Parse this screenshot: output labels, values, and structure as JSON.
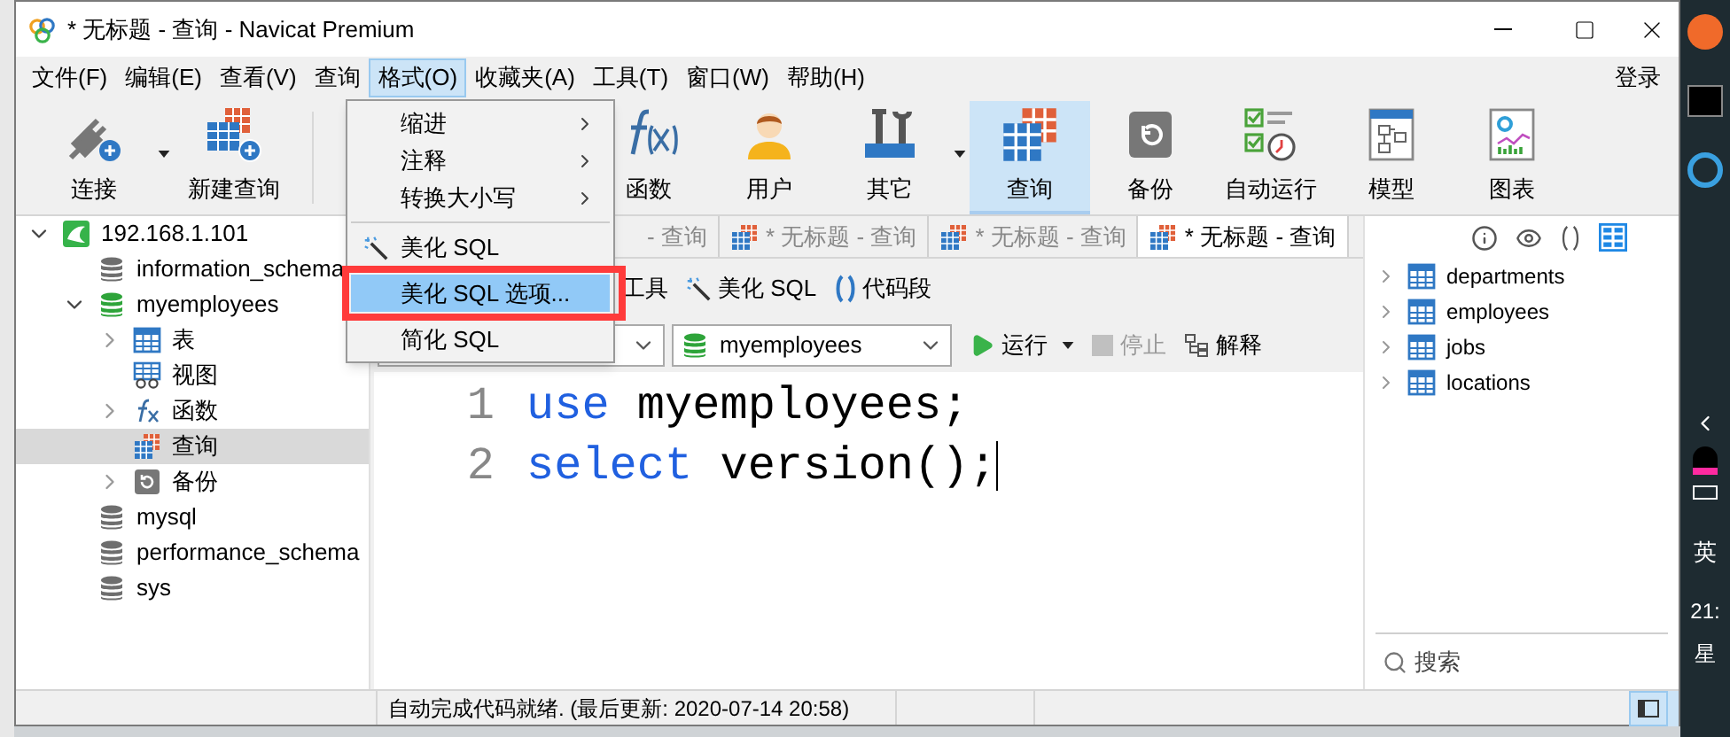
{
  "window": {
    "title": "* 无标题 - 查询 - Navicat Premium"
  },
  "menu_bar": {
    "items": [
      {
        "label": "文件(F)",
        "selected": false
      },
      {
        "label": "编辑(E)",
        "selected": false
      },
      {
        "label": "查看(V)",
        "selected": false
      },
      {
        "label": "查询",
        "selected": false
      },
      {
        "label": "格式(O)",
        "selected": true
      },
      {
        "label": "收藏夹(A)",
        "selected": false
      },
      {
        "label": "工具(T)",
        "selected": false
      },
      {
        "label": "窗口(W)",
        "selected": false
      },
      {
        "label": "帮助(H)",
        "selected": false
      }
    ],
    "login": "登录"
  },
  "toolbar": {
    "items": [
      {
        "label": "连接",
        "kind": "plug",
        "selected": false,
        "dropdown": true
      },
      {
        "label": "新建查询",
        "kind": "newquery",
        "selected": false,
        "dropdown": false
      },
      {
        "label": "函数",
        "kind": "function",
        "selected": false,
        "dropdown": false
      },
      {
        "label": "用户",
        "kind": "user",
        "selected": false,
        "dropdown": false
      },
      {
        "label": "其它",
        "kind": "tools",
        "selected": false,
        "dropdown": true
      },
      {
        "label": "查询",
        "kind": "query",
        "selected": true,
        "dropdown": false
      },
      {
        "label": "备份",
        "kind": "backup",
        "selected": false,
        "dropdown": false
      },
      {
        "label": "自动运行",
        "kind": "schedule",
        "selected": false,
        "dropdown": false
      },
      {
        "label": "模型",
        "kind": "model",
        "selected": false,
        "dropdown": false
      },
      {
        "label": "图表",
        "kind": "chart",
        "selected": false,
        "dropdown": false
      }
    ]
  },
  "format_menu": {
    "items": [
      {
        "label": "缩进",
        "kind": "submenu",
        "selected": false,
        "separator_before": false
      },
      {
        "label": "注释",
        "kind": "submenu",
        "selected": false,
        "separator_before": false
      },
      {
        "label": "转换大小写",
        "kind": "submenu",
        "selected": false,
        "separator_before": false
      },
      {
        "label": "美化 SQL",
        "kind": "wand",
        "selected": false,
        "separator_before": true
      },
      {
        "label": "美化 SQL 选项...",
        "kind": "item",
        "selected": true,
        "separator_before": false
      },
      {
        "label": "简化 SQL",
        "kind": "item",
        "selected": false,
        "separator_before": false
      }
    ]
  },
  "tree": [
    {
      "label": "192.168.1.101",
      "kind": "connection",
      "expanded": true,
      "selected": false,
      "children": [
        {
          "label": "information_schema",
          "kind": "db",
          "selected": false
        },
        {
          "label": "myemployees",
          "kind": "db_open",
          "expanded": true,
          "selected": false,
          "children": [
            {
              "label": "表",
              "kind": "table",
              "expandable": true,
              "selected": false
            },
            {
              "label": "视图",
              "kind": "view",
              "expandable": false,
              "selected": false
            },
            {
              "label": "函数",
              "kind": "function",
              "expandable": true,
              "selected": false
            },
            {
              "label": "查询",
              "kind": "query",
              "expandable": false,
              "selected": true
            },
            {
              "label": "备份",
              "kind": "backup",
              "expandable": true,
              "selected": false
            }
          ]
        },
        {
          "label": "mysql",
          "kind": "db",
          "selected": false
        },
        {
          "label": "performance_schema",
          "kind": "db",
          "selected": false
        },
        {
          "label": "sys",
          "kind": "db",
          "selected": false
        }
      ]
    }
  ],
  "editor": {
    "tabs": [
      {
        "label": "- 查询",
        "selected": false,
        "icon": false
      },
      {
        "label": "* 无标题 - 查询",
        "selected": false,
        "icon": true
      },
      {
        "label": "* 无标题 - 查询",
        "selected": false,
        "icon": true
      },
      {
        "label": "* 无标题 - 查询",
        "selected": true,
        "icon": true
      }
    ],
    "tools": [
      {
        "label": "工具",
        "kind": "plain"
      },
      {
        "label": "美化 SQL",
        "kind": "wand"
      },
      {
        "label": "代码段",
        "kind": "braces"
      }
    ],
    "database": "myemployees",
    "actions": [
      {
        "label": "运行",
        "kind": "run",
        "disabled": false
      },
      {
        "label": "停止",
        "kind": "stop",
        "disabled": true
      },
      {
        "label": "解释",
        "kind": "explain",
        "disabled": false
      }
    ],
    "lines": [
      {
        "number": "1",
        "tokens": [
          {
            "text": "use",
            "kind": "keyword"
          },
          {
            "text": " myemployees;",
            "kind": "plain"
          }
        ]
      },
      {
        "number": "2",
        "tokens": [
          {
            "text": "select",
            "kind": "keyword"
          },
          {
            "text": " version();",
            "kind": "plain"
          }
        ]
      }
    ]
  },
  "object_panel": {
    "tables": [
      "departments",
      "employees",
      "jobs",
      "locations"
    ],
    "search": {
      "placeholder": "搜索"
    }
  },
  "status_bar": {
    "text": "自动完成代码就绪. (最后更新: 2020-07-14 20:58)"
  },
  "taskbar": {
    "input_method": "英",
    "clock": "21:",
    "date": "星"
  }
}
